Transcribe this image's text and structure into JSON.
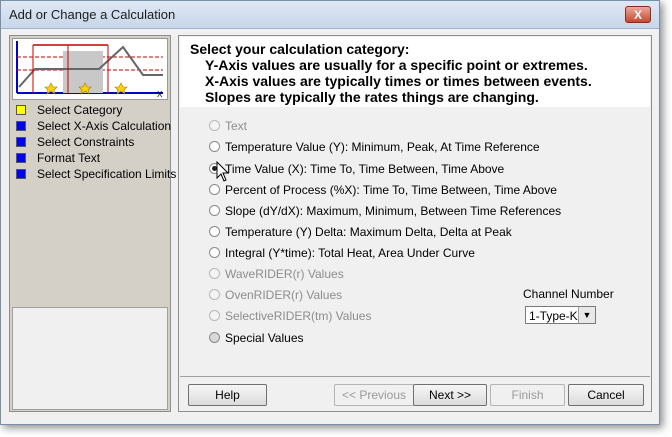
{
  "window": {
    "title": "Add or Change a Calculation",
    "close_label": "X"
  },
  "thumbnail": {
    "axis_x_label": "X"
  },
  "steps": [
    {
      "label": "Select Category",
      "color": "#ffff00"
    },
    {
      "label": "Select X-Axis Calculation",
      "color": "#0000ff"
    },
    {
      "label": "Select Constraints",
      "color": "#0000ff"
    },
    {
      "label": "Format Text",
      "color": "#0000ff"
    },
    {
      "label": "Select Specification Limits",
      "color": "#0000ff"
    }
  ],
  "header": {
    "title": "Select your calculation category:",
    "lines": [
      "Y-Axis values are usually for a specific point or extremes.",
      "X-Axis values are typically times or times between events.",
      "Slopes are typically the rates things are changing."
    ]
  },
  "options": [
    {
      "label": "Text",
      "enabled": false,
      "selected": false
    },
    {
      "label": "Temperature Value (Y):  Minimum, Peak, At Time Reference",
      "enabled": true,
      "selected": false
    },
    {
      "label": "Time Value (X):  Time To, Time Between, Time Above",
      "enabled": true,
      "selected": true
    },
    {
      "label": "Percent of Process (%X):  Time To, Time Between, Time Above",
      "enabled": true,
      "selected": false
    },
    {
      "label": "Slope (dY/dX):  Maximum, Minimum, Between Time References",
      "enabled": true,
      "selected": false
    },
    {
      "label": "Temperature (Y) Delta:  Maximum Delta, Delta at Peak",
      "enabled": true,
      "selected": false
    },
    {
      "label": "Integral (Y*time): Total Heat, Area Under Curve",
      "enabled": true,
      "selected": false
    },
    {
      "label": "WaveRIDER(r) Values",
      "enabled": false,
      "selected": false
    },
    {
      "label": "OvenRIDER(r) Values",
      "enabled": false,
      "selected": false
    },
    {
      "label": "SelectiveRIDER(tm) Values",
      "enabled": false,
      "selected": false
    },
    {
      "label": "Special  Values",
      "enabled": true,
      "selected": false
    }
  ],
  "channel": {
    "label": "Channel Number",
    "value": "1-Type-K"
  },
  "buttons": {
    "help": "Help",
    "previous": "<< Previous",
    "next": "Next >>",
    "finish": "Finish",
    "cancel": "Cancel"
  }
}
